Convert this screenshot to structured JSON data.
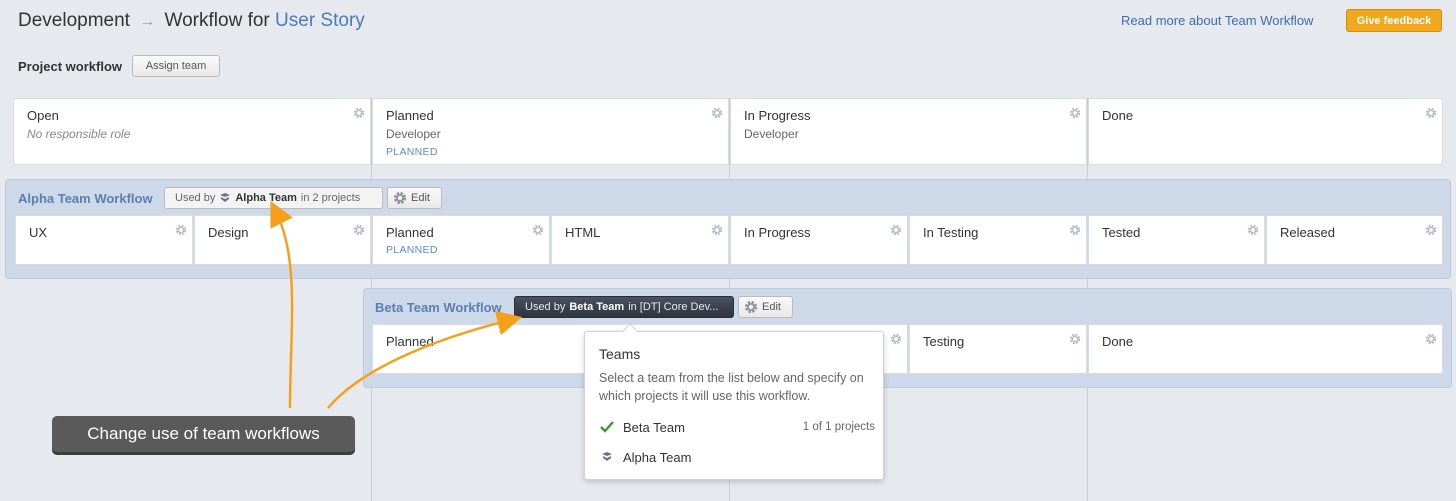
{
  "header": {
    "title_part1": "Development",
    "title_arrow": "→",
    "title_part2": "Workflow for",
    "title_entity": "User Story",
    "read_more": "Read more about Team Workflow",
    "give_feedback": "Give feedback"
  },
  "project_workflow": {
    "label": "Project workflow",
    "assign_team": "Assign team",
    "states": [
      {
        "name": "Open",
        "sub": "No responsible role",
        "tag": ""
      },
      {
        "name": "Planned",
        "sub": "Developer",
        "tag": "PLANNED"
      },
      {
        "name": "In Progress",
        "sub": "Developer",
        "tag": ""
      },
      {
        "name": "Done",
        "sub": "",
        "tag": ""
      }
    ]
  },
  "alpha_workflow": {
    "name": "Alpha Team Workflow",
    "used_by_prefix": "Used by",
    "used_by_team": "Alpha Team",
    "used_by_suffix": "in 2 projects",
    "edit": "Edit",
    "states": [
      {
        "name": "UX",
        "tag": ""
      },
      {
        "name": "Design",
        "tag": ""
      },
      {
        "name": "Planned",
        "tag": "PLANNED"
      },
      {
        "name": "HTML",
        "tag": ""
      },
      {
        "name": "In Progress",
        "tag": ""
      },
      {
        "name": "In Testing",
        "tag": ""
      },
      {
        "name": "Tested",
        "tag": ""
      },
      {
        "name": "Released",
        "tag": ""
      }
    ]
  },
  "beta_workflow": {
    "name": "Beta Team Workflow",
    "used_by_prefix": "Used by",
    "used_by_team": "Beta Team",
    "used_by_suffix": "in [DT] Core Dev...",
    "edit": "Edit",
    "states": [
      {
        "name": "Planned"
      },
      {
        "name": "Testing"
      },
      {
        "name": "Done"
      }
    ]
  },
  "teams_popover": {
    "title": "Teams",
    "description": "Select a team from the list below and specify on which projects it will use this workflow.",
    "teams": [
      {
        "name": "Beta Team",
        "count": "1 of 1 projects",
        "selected": true
      },
      {
        "name": "Alpha Team",
        "count": "",
        "selected": false
      }
    ]
  },
  "callout": {
    "text": "Change use of team workflows"
  },
  "colors": {
    "accent": "#4a7bbb",
    "feedback": "#f2a81d",
    "team_block": "#cdd8e8",
    "annotation_arrow": "#f5a01a",
    "check": "#3a9a2a"
  }
}
